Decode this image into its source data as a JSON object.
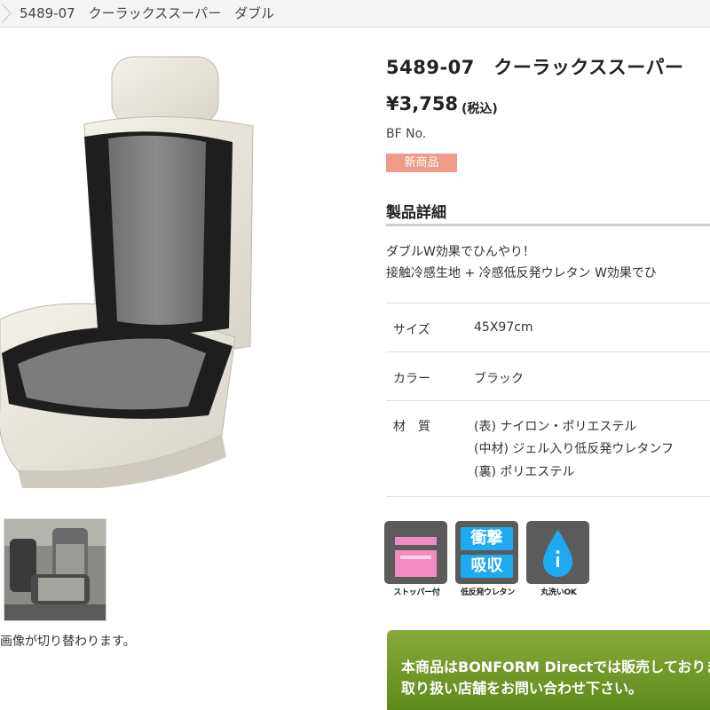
{
  "breadcrumb": {
    "current": "5489-07　クーラックススーパー　ダブル"
  },
  "product": {
    "title": "5489-07　クーラックススーパー",
    "price": "¥3,758",
    "tax_note": "(税込)",
    "bf_no": "BF No.",
    "badge": "新商品"
  },
  "gallery": {
    "thumb_note": "画像が切り替わります。"
  },
  "details": {
    "heading": "製品詳細",
    "desc_line1": "ダブルW効果でひんやり！",
    "desc_line2": "接触冷感生地 + 冷感低反発ウレタン W効果でひ",
    "specs": {
      "size_label": "サイズ",
      "size_value": "45X97cm",
      "color_label": "カラー",
      "color_value": "ブラック",
      "material_label": "材　質",
      "material_lines": [
        "(表) ナイロン・ポリエステル",
        "(中材) ジェル入り低反発ウレタンフ",
        "(裏) ポリエステル"
      ]
    }
  },
  "features": [
    {
      "icon": "stopper-icon",
      "caption": "ストッパー付"
    },
    {
      "icon": "impact-absorb-icon",
      "line1": "衝撃",
      "line2": "吸収",
      "caption": "低反発ウレタン"
    },
    {
      "icon": "water-drop-icon",
      "caption": "丸洗いOK"
    }
  ],
  "notice": {
    "line1": "本商品はBONFORM Directでは販売しておりま",
    "line2": "取り扱い店舗をお問い合わせ下さい。"
  },
  "colors": {
    "badge": "#f09a8a",
    "impact_blue": "#1eaaf0",
    "notice_green": "#6b8e23",
    "feature_gray": "#5b5b5b"
  }
}
